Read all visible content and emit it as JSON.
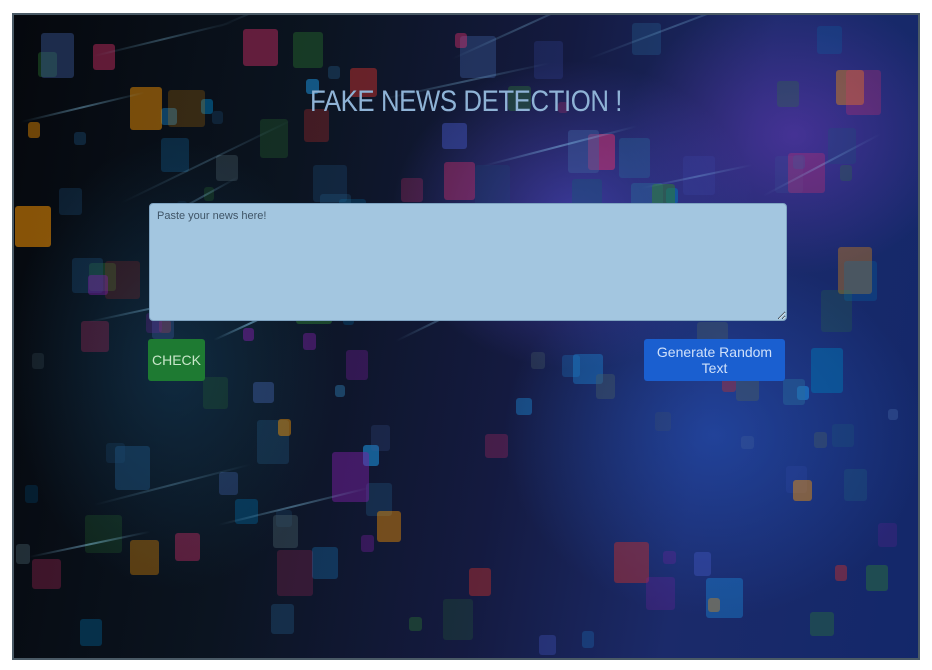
{
  "page": {
    "title": "FAKE NEWS DETECTION !"
  },
  "form": {
    "news_placeholder": "Paste your news here!",
    "news_value": "",
    "check_label": "CHECK",
    "random_label": "Generate Random Text"
  },
  "colors": {
    "title": "#8fb3d6",
    "textarea_bg": "#a3c6e0",
    "check_button": "#1e7a32",
    "random_button": "#1a5fd0"
  },
  "background": {
    "description_icon": "social-media-globe-background"
  }
}
